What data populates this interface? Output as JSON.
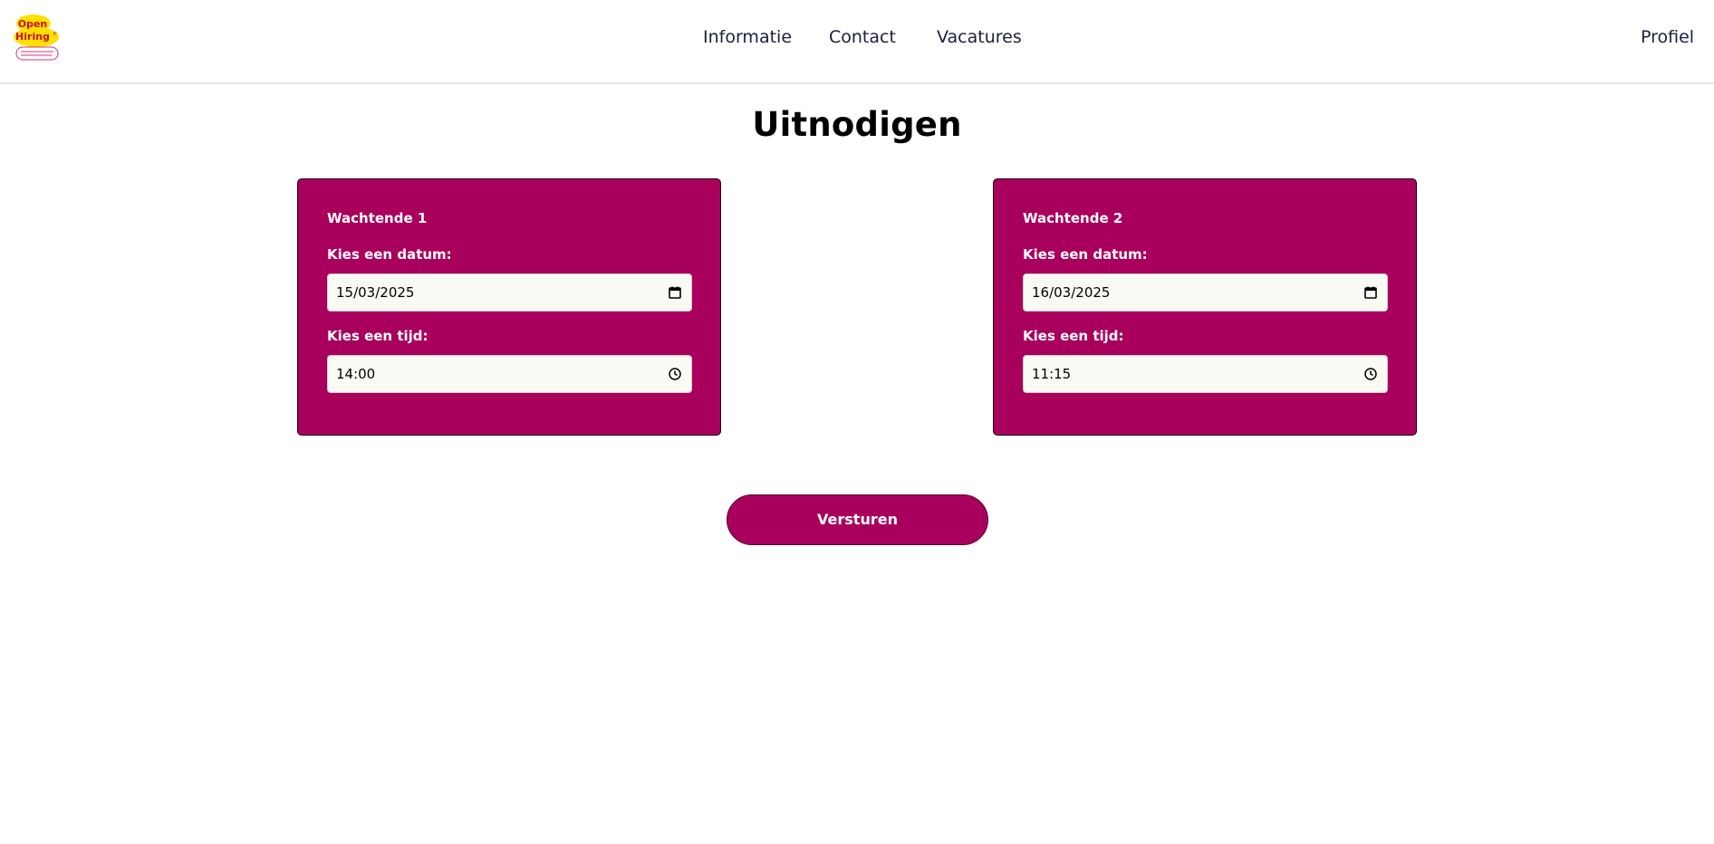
{
  "logo": {
    "line1": "Open",
    "line2": "Hiring",
    "registered": "®",
    "tagline": "",
    "colors": {
      "yellow": "#ffe000",
      "pink": "#e0307a",
      "red": "#c8102e"
    }
  },
  "nav": {
    "items": [
      {
        "label": "Informatie"
      },
      {
        "label": "Contact"
      },
      {
        "label": "Vacatures"
      }
    ],
    "profile_label": "Profiel"
  },
  "page": {
    "title": "Uitnodigen"
  },
  "candidates": [
    {
      "title": "Wachtende 1",
      "date_label": "Kies een datum:",
      "date_value": "15/03/2025",
      "time_label": "Kies een tijd:",
      "time_value": "14:00"
    },
    {
      "title": "Wachtende 2",
      "date_label": "Kies een datum:",
      "date_value": "16/03/2025",
      "time_label": "Kies een tijd:",
      "time_value": "11:15"
    }
  ],
  "actions": {
    "submit_label": "Versturen"
  },
  "colors": {
    "accent": "#a8005c",
    "header_border": "#e4e4e4",
    "field_bg": "#fafaf5"
  },
  "icons": {
    "date": "calendar-icon",
    "time": "clock-icon"
  }
}
